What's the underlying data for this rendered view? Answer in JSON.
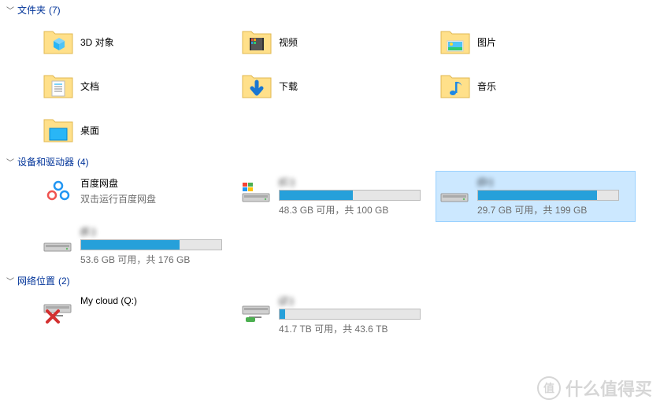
{
  "sections": {
    "folders": {
      "title": "文件夹",
      "count": "(7)"
    },
    "drives": {
      "title": "设备和驱动器",
      "count": "(4)"
    },
    "network": {
      "title": "网络位置",
      "count": "(2)"
    }
  },
  "folders": {
    "objects3d": "3D 对象",
    "videos": "视频",
    "pictures": "图片",
    "documents": "文档",
    "downloads": "下载",
    "music": "音乐",
    "desktop": "桌面"
  },
  "drives": {
    "baidu": {
      "name": "百度网盘",
      "sub": "双击运行百度网盘"
    },
    "c": {
      "name": "(C:)",
      "stats": "48.3 GB 可用，共 100 GB",
      "fill": 52
    },
    "d": {
      "name": "(D:)",
      "stats": "29.7 GB 可用，共 199 GB",
      "fill": 85
    },
    "e": {
      "name": "(E:)",
      "stats": "53.6 GB 可用，共 176 GB",
      "fill": 70
    }
  },
  "network": {
    "mycloud": {
      "name": "My cloud (Q:)"
    },
    "z": {
      "name": "(Z:)",
      "stats": "41.7 TB 可用，共 43.6 TB",
      "fill": 4
    }
  },
  "watermark": {
    "small": "值",
    "text": "什么值得买"
  }
}
